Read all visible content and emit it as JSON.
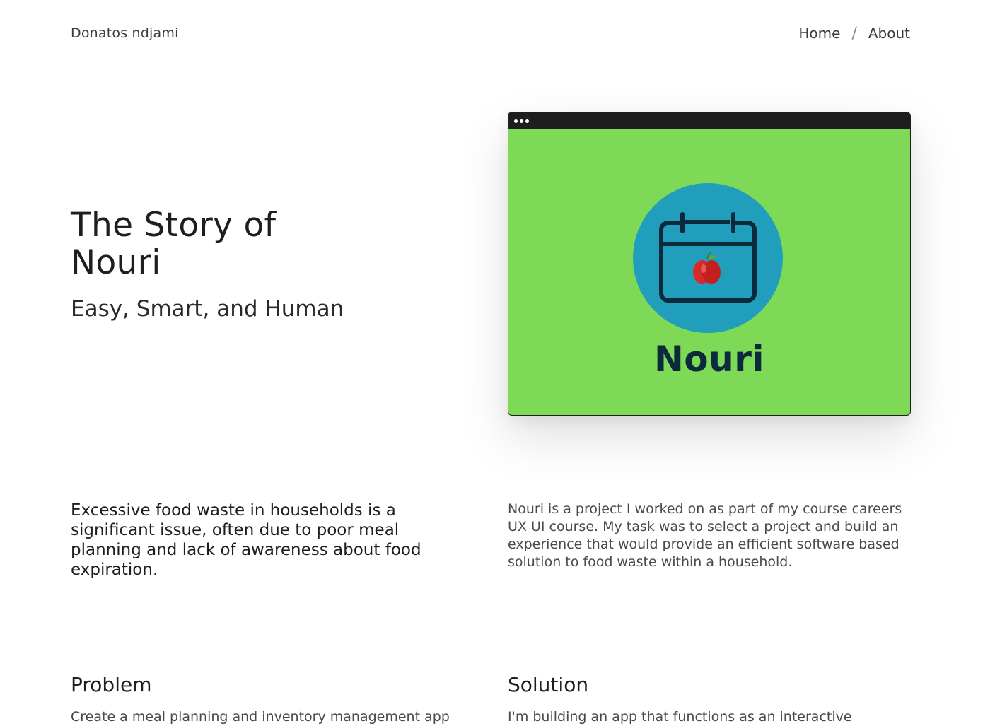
{
  "header": {
    "brand": "Donatos ndjami",
    "nav": {
      "home": "Home",
      "separator": "/",
      "about": "About"
    }
  },
  "hero": {
    "title_line1": "The Story of",
    "title_line2": "Nouri",
    "subtitle": "Easy, Smart, and Human",
    "image": {
      "logo_text": "Nouri",
      "background_color": "#7ed957",
      "circle_color": "#219ebc",
      "icon": "calendar-apple-icon"
    }
  },
  "intro": {
    "statement": "Excessive food waste in households is a significant issue, often due to poor meal planning and lack of awareness about food expiration.",
    "description": "Nouri is a project I worked on as part of my course careers UX UI course. My task was to select a project and build an experience that would provide an efficient software based solution to food waste within a household."
  },
  "sections": {
    "problem": {
      "title": "Problem",
      "body": "Create a meal planning and inventory management app"
    },
    "solution": {
      "title": "Solution",
      "body": "I'm building an app that functions as an interactive"
    }
  }
}
